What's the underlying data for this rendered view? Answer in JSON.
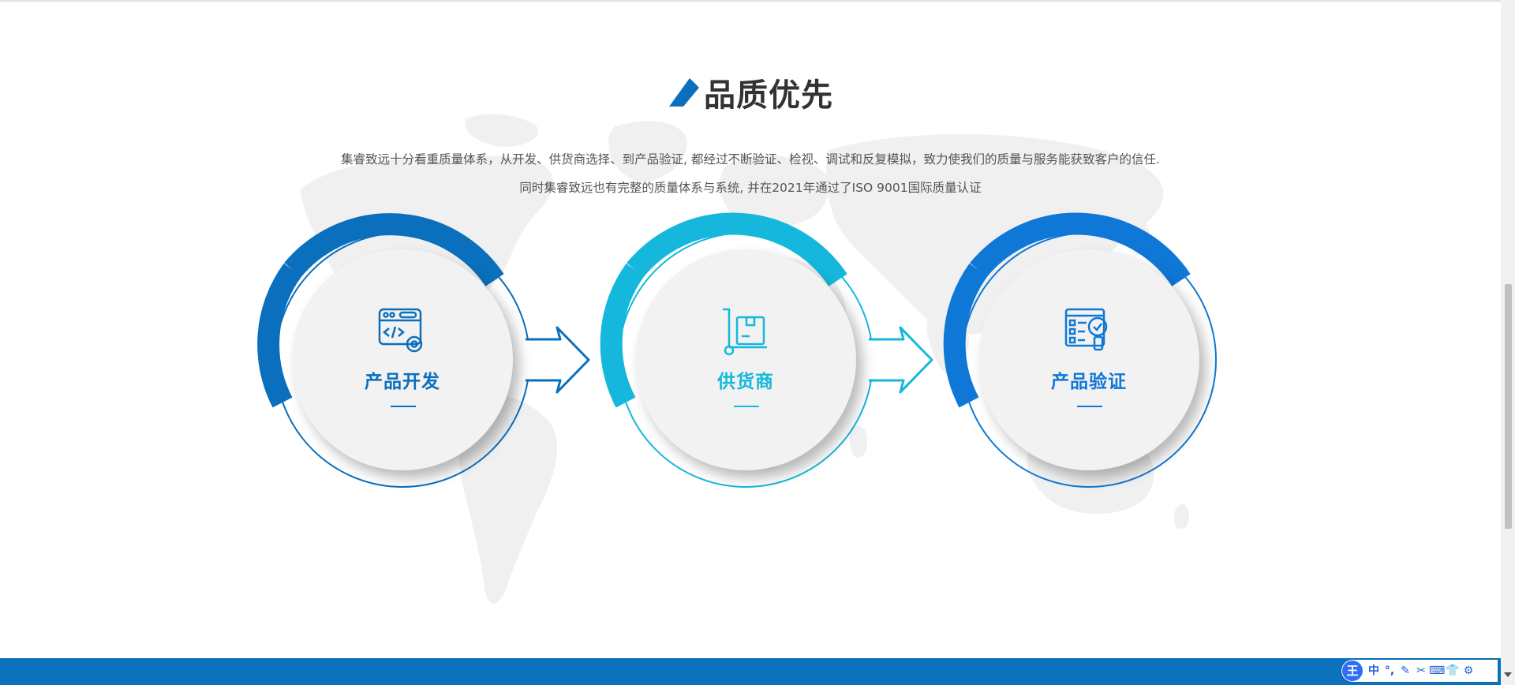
{
  "section": {
    "title": "品质优先",
    "description_line1": "集睿致远十分看重质量体系，从开发、供货商选择、到产品验证, 都经过不断验证、检视、调试和反复模拟，致力使我们的质量与服务能获致客户的信任.",
    "description_line2": "同时集睿致远也有完整的质量体系与系统, 并在2021年通过了ISO 9001国际质量认证"
  },
  "steps": [
    {
      "label": "产品开发",
      "icon": "code-window-gear-icon",
      "color": "#0a6fbd"
    },
    {
      "label": "供货商",
      "icon": "hand-truck-box-icon",
      "color": "#15b8dc"
    },
    {
      "label": "产品验证",
      "icon": "checklist-magnifier-icon",
      "color": "#0f78d6"
    }
  ],
  "ime_toolbar": {
    "logo": "王",
    "mode": "中",
    "items": [
      "°,",
      "✎",
      "✂",
      "⌨",
      "👕",
      "⚙"
    ]
  },
  "colors": {
    "brand_blue": "#0c72bd",
    "cyan": "#15b8dc",
    "title_text": "#333333",
    "map_gray": "#f0f0f0"
  }
}
